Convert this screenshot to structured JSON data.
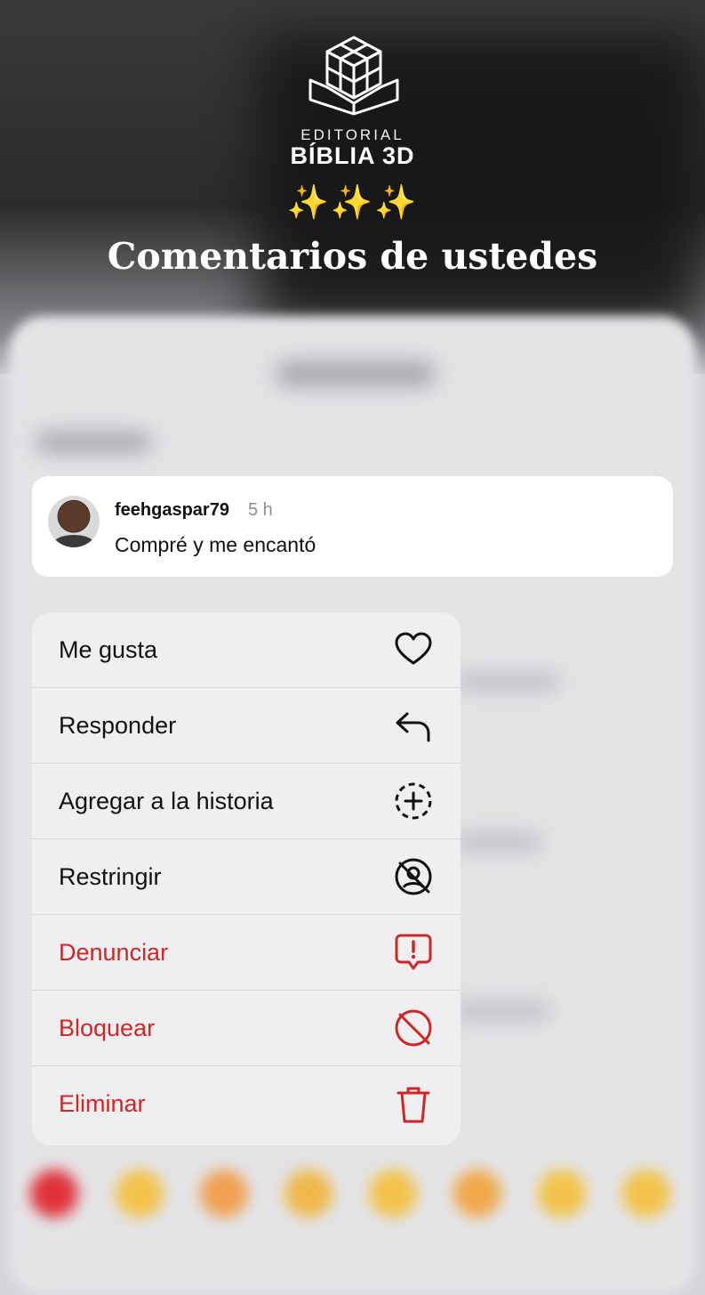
{
  "brand": {
    "small": "EDITORIAL",
    "big": "BÍBLIA 3D",
    "sparkles": "✨✨✨"
  },
  "headline": "Comentarios de ustedes",
  "comment": {
    "username": "feehgaspar79",
    "time": "5 h",
    "text": "Compré y me encantó"
  },
  "menu": {
    "items": [
      {
        "label": "Me gusta",
        "icon": "heart-icon",
        "color": "#111111"
      },
      {
        "label": "Responder",
        "icon": "reply-icon",
        "color": "#111111"
      },
      {
        "label": "Agregar a la historia",
        "icon": "add-story-icon",
        "color": "#111111"
      },
      {
        "label": "Restringir",
        "icon": "restrict-icon",
        "color": "#111111"
      },
      {
        "label": "Denunciar",
        "icon": "report-icon",
        "color": "#cf2626"
      },
      {
        "label": "Bloquear",
        "icon": "block-icon",
        "color": "#cf2626"
      },
      {
        "label": "Eliminar",
        "icon": "trash-icon",
        "color": "#cf2626"
      }
    ]
  },
  "colors": {
    "danger": "#cf2626",
    "menu_bg": "#efeff1",
    "card_bg": "#ffffff"
  }
}
